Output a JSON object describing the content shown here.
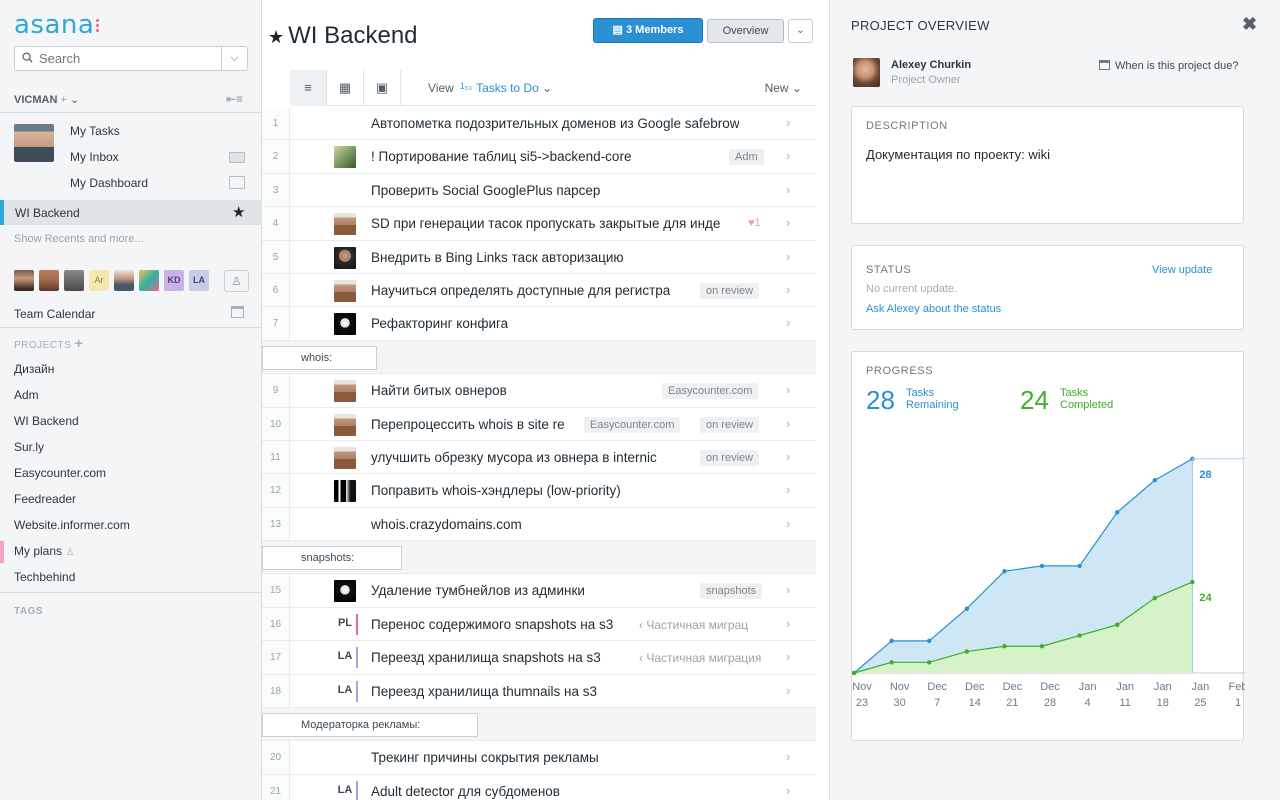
{
  "sidebar": {
    "logo": "asana",
    "search_placeholder": "Search",
    "workspace": "VICMAN",
    "my_links": [
      "My Tasks",
      "My Inbox",
      "My Dashboard"
    ],
    "active_item": "WI Backend",
    "recents_link": "Show Recents and more...",
    "team_avatars": [
      {
        "label": "",
        "color": "#7a5a46"
      },
      {
        "label": "",
        "color": "#a0694d"
      },
      {
        "label": "",
        "color": "#4a4a4a"
      },
      {
        "label": "Ar",
        "color": "#f6e7b3"
      },
      {
        "label": "",
        "color": "#6f7780"
      },
      {
        "label": "",
        "color": "#2fb2a2"
      },
      {
        "label": "KD",
        "color": "#c8b2e6"
      },
      {
        "label": "LA",
        "color": "#c8cde6"
      }
    ],
    "team_calendar": "Team Calendar",
    "projects_header": "PROJECTS",
    "projects": [
      "Дизайн",
      "Adm",
      "WI Backend",
      "Sur.ly",
      "Easycounter.com",
      "Feedreader",
      "Website.informer.com",
      "My plans",
      "Techbehind"
    ],
    "tags_header": "TAGS"
  },
  "main": {
    "title": "WI Backend",
    "members_button": "3 Members",
    "overview_button": "Overview",
    "view_label": "View",
    "view_sort_icon": "sort-numeric-icon",
    "view_sort": "Tasks to Do",
    "new_label": "New",
    "rows": [
      {
        "num": "1",
        "text": "Автопометка подозрительных доменов из Google safebrow",
        "avatar": "",
        "tags": []
      },
      {
        "num": "2",
        "text": "! Портирование таблиц si5->backend-core",
        "avatar": "a2",
        "tags": [
          "Adm"
        ]
      },
      {
        "num": "3",
        "text": "Проверить Social GooglePlus парсер",
        "avatar": "",
        "tags": []
      },
      {
        "num": "4",
        "text": "SD при генерации тасок пропускать закрытые для инде",
        "avatar": "a1",
        "tags": [],
        "heart": "♥1"
      },
      {
        "num": "5",
        "text": "Внедрить в Bing Links таск авторизацию",
        "avatar": "a3",
        "tags": []
      },
      {
        "num": "6",
        "text": "Научиться определять доступные для регистра",
        "avatar": "a1",
        "tags": [
          "on review"
        ]
      },
      {
        "num": "7",
        "text": "Рефакторинг конфига",
        "avatar": "a4",
        "tags": []
      },
      {
        "section": "whois:"
      },
      {
        "num": "9",
        "text": "Найти битых овнеров",
        "avatar": "a1",
        "tags": [
          "Easycounter.com"
        ]
      },
      {
        "num": "10",
        "text": "Перепроцессить whois в site re",
        "avatar": "a1",
        "tags": [
          "Easycounter.com",
          "on review"
        ]
      },
      {
        "num": "11",
        "text": "улучшить обрезку мусора из овнера в internic",
        "avatar": "a1",
        "tags": [
          "on review"
        ]
      },
      {
        "num": "12",
        "text": "Поправить whois-хэндлеры (low-priority)",
        "avatar": "a5",
        "tags": []
      },
      {
        "num": "13",
        "text": "whois.crazydomains.com",
        "avatar": "",
        "tags": []
      },
      {
        "section": "snapshots:"
      },
      {
        "num": "15",
        "text": "Удаление тумбнейлов из админки",
        "avatar": "a4",
        "tags": [
          "snapshots"
        ]
      },
      {
        "num": "16",
        "text": "Перенос содержимого snapshots на s3",
        "initials": "PL",
        "initials_color": "#e86a8a",
        "tags": [],
        "parent": "‹ Частичная миграц"
      },
      {
        "num": "17",
        "text": "Переезд хранилища snapshots на s3",
        "initials": "LA",
        "initials_color": "#9fa7e0",
        "tags": [],
        "parent": "‹ Частичная миграция"
      },
      {
        "num": "18",
        "text": "Переезд хранилища thumnails на s3",
        "initials": "LA",
        "initials_color": "#9fa7e0",
        "tags": []
      },
      {
        "section": "Модераторка рекламы:"
      },
      {
        "num": "20",
        "text": "Трекинг причины сокрытия рекламы",
        "avatar": "",
        "tags": []
      },
      {
        "num": "21",
        "text": "Adult detector для субдоменов",
        "initials": "LA",
        "initials_color": "#9fa7e0",
        "tags": []
      }
    ]
  },
  "panel": {
    "title": "PROJECT OVERVIEW",
    "owner_name": "Alexey Churkin",
    "owner_role": "Project Owner",
    "due_link": "When is this project due?",
    "description_label": "DESCRIPTION",
    "description": "Документация по проекту: wiki",
    "status_label": "STATUS",
    "view_update": "View update",
    "no_update": "No current update.",
    "ask_status": "Ask Alexey about the status",
    "progress_label": "PROGRESS",
    "remaining_num": "28",
    "remaining_lbl1": "Tasks",
    "remaining_lbl2": "Remaining",
    "completed_num": "24",
    "completed_lbl1": "Tasks",
    "completed_lbl2": "Completed",
    "remaining_color": "#2b8fd3",
    "completed_color": "#3fae2a"
  },
  "chart_data": {
    "type": "area",
    "x_ticks": [
      [
        "Nov",
        "23"
      ],
      [
        "Nov",
        "30"
      ],
      [
        "Dec",
        "7"
      ],
      [
        "Dec",
        "14"
      ],
      [
        "Dec",
        "21"
      ],
      [
        "Dec",
        "28"
      ],
      [
        "Jan",
        "4"
      ],
      [
        "Jan",
        "11"
      ],
      [
        "Jan",
        "18"
      ],
      [
        "Jan",
        "25"
      ],
      [
        "Feb",
        "1"
      ]
    ],
    "series": [
      {
        "name": "Tasks Remaining",
        "color": "#2b8fd3",
        "values": [
          0,
          6,
          6,
          12,
          19,
          20,
          20,
          30,
          36,
          40
        ],
        "end_label": "28"
      },
      {
        "name": "Tasks Completed",
        "color": "#3fae2a",
        "values": [
          0,
          2,
          2,
          4,
          5,
          5,
          7,
          9,
          14,
          17
        ],
        "end_label": "24"
      }
    ],
    "ylim": [
      0,
      45
    ],
    "grid": false
  }
}
